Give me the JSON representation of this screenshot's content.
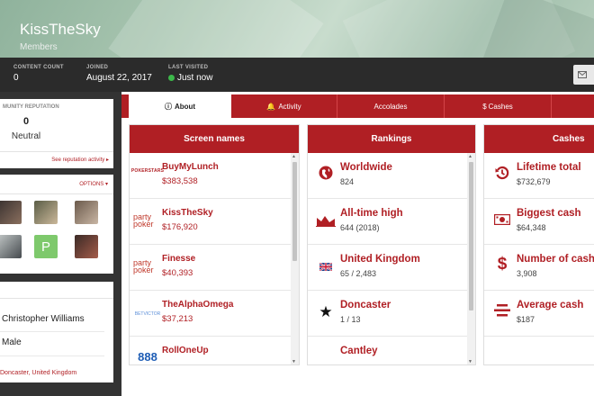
{
  "header": {
    "username": "KissTheSky",
    "role": "Members"
  },
  "stats": {
    "content_count_label": "CONTENT COUNT",
    "content_count": "0",
    "joined_label": "JOINED",
    "joined": "August 22, 2017",
    "last_visited_label": "LAST VISITED",
    "last_visited": "Just now",
    "online_color": "#3cb84a"
  },
  "sidebar": {
    "reputation_label": "MUNITY REPUTATION",
    "reputation_value": "0",
    "reputation_status": "Neutral",
    "reputation_link": "See reputation activity",
    "options_label": "OPTIONS",
    "friend_avatar_letter": "P",
    "about_name": "Christopher Williams",
    "about_gender": "Male",
    "about_location": "Doncaster, United Kingdom"
  },
  "tabs": [
    "About",
    "Activity",
    "Accolades",
    "Cashes"
  ],
  "panels": {
    "screen_names": {
      "title": "Screen names",
      "items": [
        {
          "logo": "POKERSTARS",
          "name": "BuyMyLunch",
          "amount": "$383,538"
        },
        {
          "logo": "party poker",
          "name": "KissTheSky",
          "amount": "$176,920"
        },
        {
          "logo": "party poker",
          "name": "Finesse",
          "amount": "$40,393"
        },
        {
          "logo": "BETVICTOR",
          "name": "TheAlphaOmega",
          "amount": "$37,213"
        },
        {
          "logo": "888",
          "name": "RollOneUp",
          "amount": ""
        }
      ]
    },
    "rankings": {
      "title": "Rankings",
      "items": [
        {
          "icon": "globe-icon",
          "title": "Worldwide",
          "value": "824"
        },
        {
          "icon": "area-chart-icon",
          "title": "All-time high",
          "value": "644 (2018)"
        },
        {
          "icon": "uk-flag-icon",
          "title": "United Kingdom",
          "value": "65 / 2,483"
        },
        {
          "icon": "star-icon",
          "title": "Doncaster",
          "value": "1 / 13"
        },
        {
          "icon": "star-icon",
          "title": "Cantley",
          "value": ""
        }
      ]
    },
    "cashes": {
      "title": "Cashes",
      "items": [
        {
          "icon": "history-icon",
          "title": "Lifetime total",
          "value": "$732,679"
        },
        {
          "icon": "cash-icon",
          "title": "Biggest cash",
          "value": "$64,348"
        },
        {
          "icon": "dollar-icon",
          "title": "Number of cashes",
          "value": "3,908"
        },
        {
          "icon": "balance-icon",
          "title": "Average cash",
          "value": "$187"
        }
      ]
    }
  },
  "colors": {
    "accent": "#b01f24",
    "dark_bar": "#2b2b2b"
  }
}
